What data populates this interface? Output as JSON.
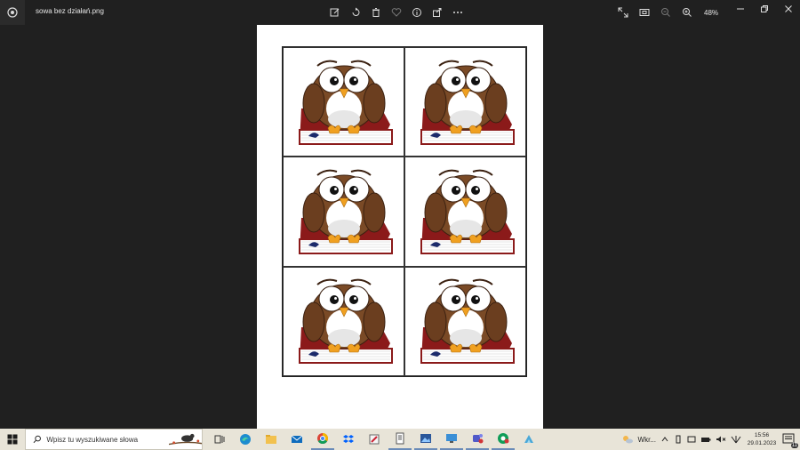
{
  "titlebar": {
    "filename": "sowa bez działań.png",
    "zoom": "48%"
  },
  "toolbar": {
    "icons": [
      "edit-icon",
      "rotate-icon",
      "delete-icon",
      "favorite-icon",
      "info-icon",
      "share-icon",
      "more-icon"
    ]
  },
  "cards": [
    {
      "id": "owl-1"
    },
    {
      "id": "owl-2"
    },
    {
      "id": "owl-3"
    },
    {
      "id": "owl-4"
    },
    {
      "id": "owl-5"
    },
    {
      "id": "owl-6"
    }
  ],
  "taskbar": {
    "search_placeholder": "Wpisz tu wyszukiwane słowa",
    "weather": "Wkr...",
    "time": "15:56",
    "date": "29.01.2023",
    "notification_count": "11"
  },
  "colors": {
    "app_bg": "#202020",
    "taskbar_bg": "#e8e4d8",
    "owl_brown": "#7a4a26",
    "book_red": "#8b1a1a"
  }
}
